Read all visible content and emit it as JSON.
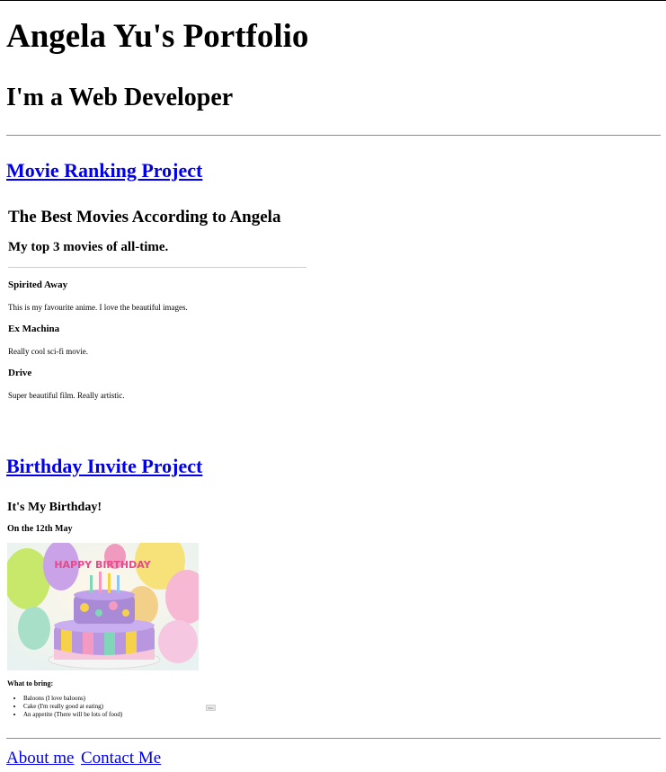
{
  "page": {
    "title": "Angela Yu's Portfolio",
    "subtitle": "I'm a Web Developer"
  },
  "projects": {
    "movie": {
      "link_label": "Movie Ranking Project",
      "frame": {
        "heading": "The Best Movies According to Angela",
        "subheading": "My top 3 movies of all-time.",
        "movies": [
          {
            "title": "Spirited Away",
            "desc": "This is my favourite anime. I love the beautiful images."
          },
          {
            "title": "Ex Machina",
            "desc": "Really cool sci-fi movie."
          },
          {
            "title": "Drive",
            "desc": "Super beautiful film. Really artistic."
          }
        ]
      }
    },
    "birthday": {
      "link_label": "Birthday Invite Project",
      "frame": {
        "heading": "It's My Birthday!",
        "date": "On the 12th May",
        "image_alt": "birthday cake",
        "cake_text": "HAPPY BIRTHDAY",
        "bring_heading": "What to bring:",
        "items": [
          "Baloons (I love baloons)",
          "Cake (I'm really good at eating)",
          "An appetite (There will be lots of food)"
        ],
        "button_label": "Pano"
      }
    }
  },
  "footer": {
    "about": "About me",
    "contact": "Contact Me"
  },
  "colors": {
    "link": "#0000ee",
    "rule": "#8c8c8c"
  }
}
